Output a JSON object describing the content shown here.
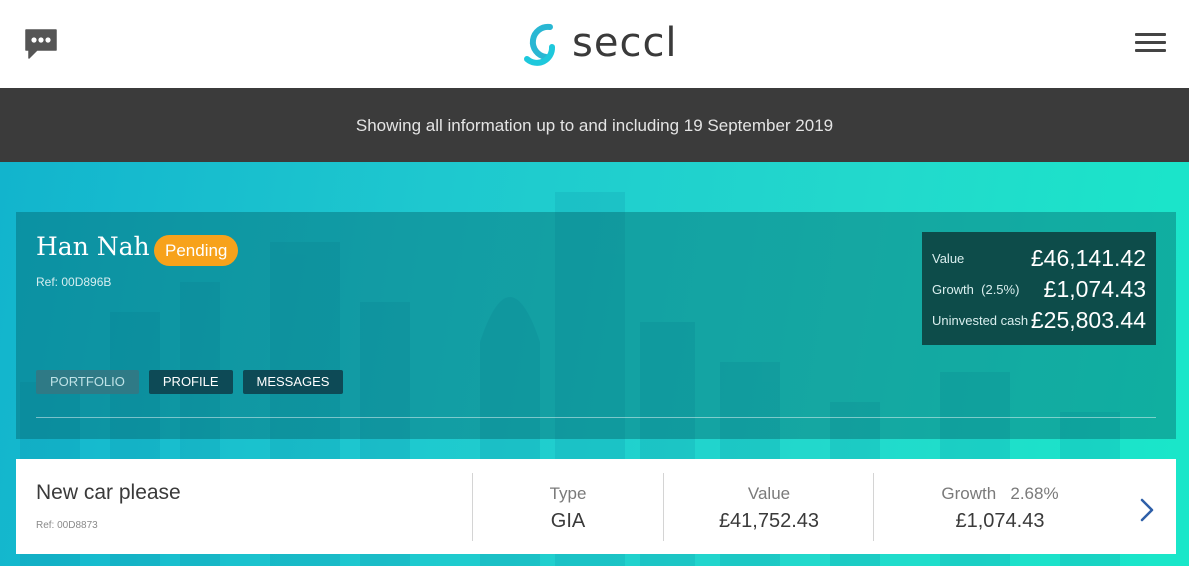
{
  "header": {
    "logo_text": "seccl",
    "chat_icon": "speech-bubble-icon",
    "menu_icon": "hamburger-menu-icon",
    "brand_color": "#29b7d3"
  },
  "info_bar": {
    "text": "Showing all information up to and including 19 September 2019"
  },
  "client": {
    "name": "Han Nah",
    "status": "Pending",
    "ref": "Ref: 00D896B"
  },
  "summary": {
    "value_label": "Value",
    "value": "£46,141.42",
    "growth_label": "Growth",
    "growth_pct": "(2.5%)",
    "growth": "£1,074.43",
    "cash_label": "Uninvested cash",
    "cash": "£25,803.44"
  },
  "tabs": [
    {
      "label": "PORTFOLIO",
      "active": true
    },
    {
      "label": "PROFILE",
      "active": false
    },
    {
      "label": "MESSAGES",
      "active": false
    }
  ],
  "account": {
    "title": "New car please",
    "ref": "Ref: 00D8873",
    "type_label": "Type",
    "type": "GIA",
    "value_label": "Value",
    "value": "£41,752.43",
    "growth_label": "Growth",
    "growth_pct": "2.68%",
    "growth": "£1,074.43",
    "chevron_icon": "chevron-right-icon"
  },
  "colors": {
    "status_badge": "#f7a21b",
    "info_bar": "#3b3b3b",
    "summary_box": "#0d4c4a",
    "chevron": "#2e5fa8"
  }
}
